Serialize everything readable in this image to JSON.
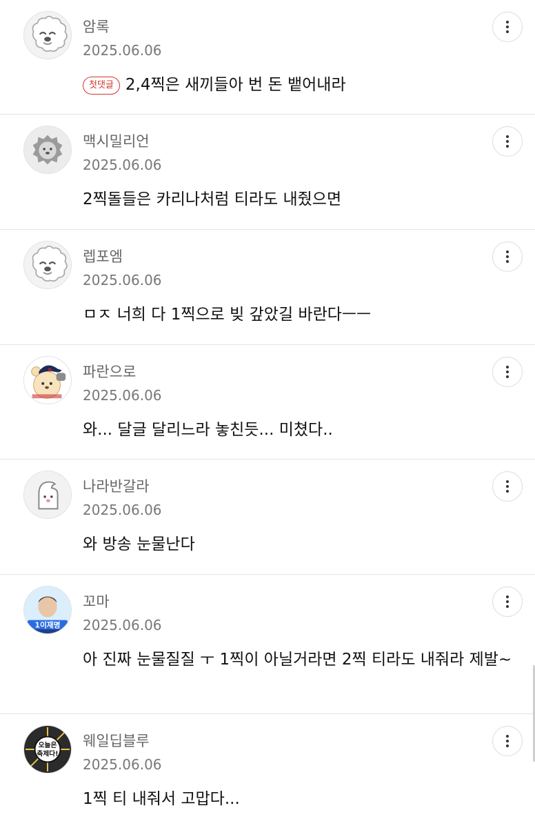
{
  "first_comment_badge": "첫댓글",
  "comments": [
    {
      "nickname": "암록",
      "date": "2025.06.06",
      "text": "2,4찍은 새끼들아 번 돈 뱉어내라",
      "avatar_icon": "poodle-avatar-icon",
      "first": true
    },
    {
      "nickname": "맥시밀리언",
      "date": "2025.06.06",
      "text": "2찍돌들은 카리나처럼 티라도 내줬으면",
      "avatar_icon": "lion-avatar-icon"
    },
    {
      "nickname": "렙포엠",
      "date": "2025.06.06",
      "text": "ㅁㅈ 너희 다 1찍으로 빚 갚았길 바란다ㅡㅡ",
      "avatar_icon": "poodle-avatar-icon"
    },
    {
      "nickname": "파란으로",
      "date": "2025.06.06",
      "text": "와... 달글 달리느라 놓친듯... 미쳤다..",
      "avatar_icon": "bear-cap-avatar-icon"
    },
    {
      "nickname": "나라반갈라",
      "date": "2025.06.06",
      "text": "와 방송 눈물난다",
      "avatar_icon": "ghost-avatar-icon"
    },
    {
      "nickname": "꼬마",
      "date": "2025.06.06",
      "text": "아 진짜 눈물질질 ㅜ 1찍이 아닐거라면 2찍 티라도 내줘라 제발~",
      "avatar_icon": "portrait-avatar-icon",
      "avatar_text": "1이재명"
    },
    {
      "nickname": "웨일딥블루",
      "date": "2025.06.06",
      "text": "1찍 티 내줘서 고맙다...",
      "avatar_icon": "sticker-avatar-icon",
      "avatar_text": "오늘은 축제다!"
    }
  ],
  "colors": {
    "badge": "#d0342c",
    "divider": "#e4e4e4",
    "nickname": "#666666"
  }
}
